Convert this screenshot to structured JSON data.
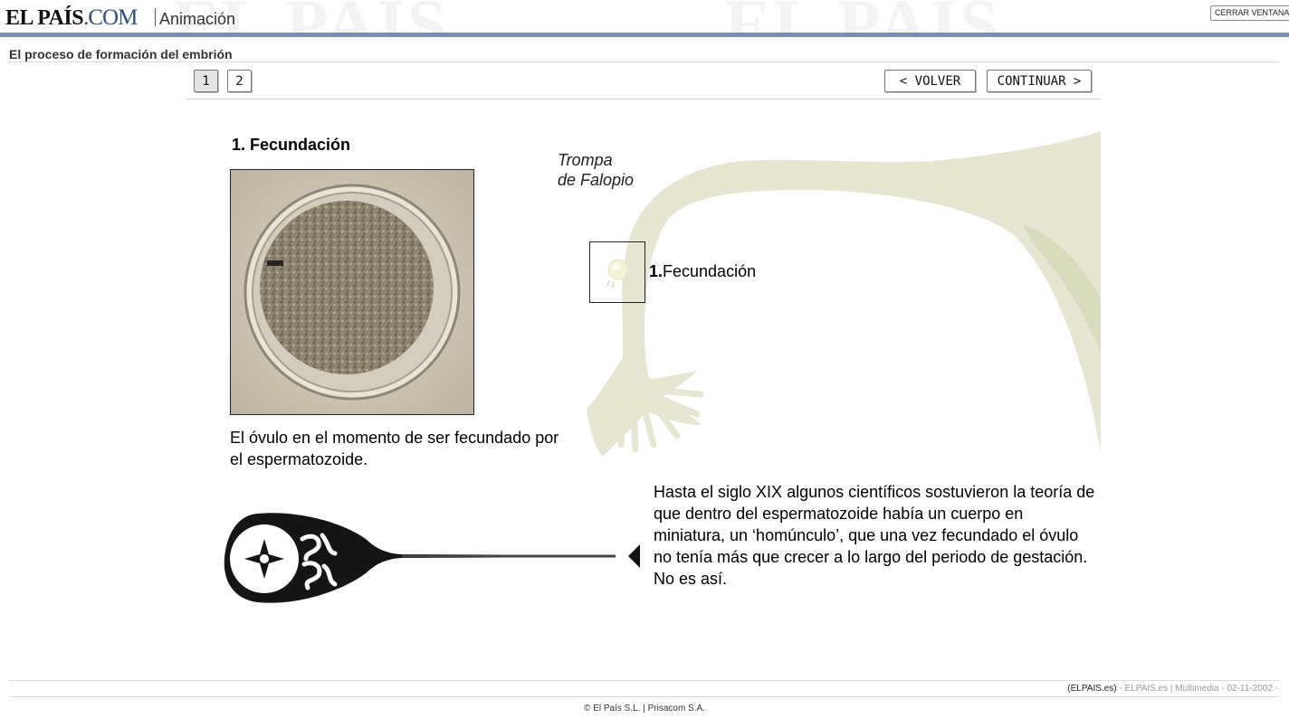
{
  "header": {
    "watermark": "EL PAÍS",
    "logo_main": "EL PAÍS",
    "logo_com": ".COM",
    "section": "Animación",
    "close_button": "CERRAR VENTANA"
  },
  "page": {
    "heading": "El proceso de formación del embrión"
  },
  "nav": {
    "pages": [
      "1",
      "2"
    ],
    "active_page": "1",
    "back_label": "< VOLVER",
    "continue_label": "CONTINUAR >"
  },
  "content": {
    "step_title": "1. Fecundación",
    "photo_caption": "El óvulo en el momento de ser fecundado por el espermatozoide.",
    "tube_label_line1": "Trompa",
    "tube_label_line2": "de Falopio",
    "marker_number": "1.",
    "marker_text": "Fecundación",
    "history_text": "Hasta el siglo XIX algunos científicos sostuvieron la teoría de que dentro del espermatozoide había un cuerpo en miniatura, un ‘homúnculo’, que una vez fecundado el óvulo no tenía más que crecer a lo largo del periodo de gestación. No es así."
  },
  "footer": {
    "credit_source": "(ELPAIS.es)",
    "credit_rest": " - ELPAIS.es | Multimedia - 02-11-2002 -",
    "copyright": "© El País S.L. | Prisacom S.A."
  },
  "colors": {
    "header_bar": "#7a8fae",
    "logo_com": "#2f4f7f",
    "tube_fill": "#e6e6d3",
    "tube_shade": "#d9dbbd"
  }
}
